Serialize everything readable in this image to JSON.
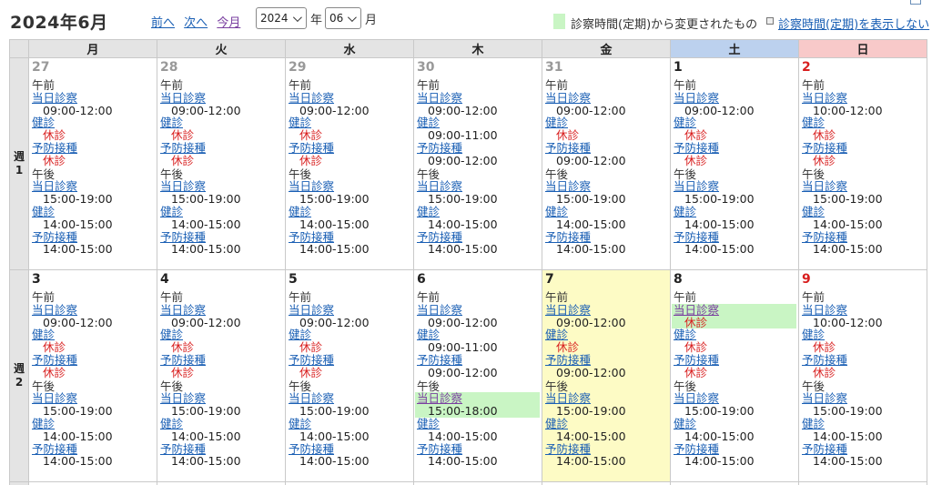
{
  "header": {
    "title": "2024年6月",
    "nav": {
      "prev": "前へ",
      "next": "次へ",
      "current": "今月"
    },
    "year_value": "2024",
    "year_unit": "年",
    "month_value": "06",
    "month_unit": "月",
    "legend_text": "診察時間(定期)から変更されたもの",
    "hide_link": "診察時間(定期)を表示しない",
    "colors": {
      "changed": "#c9f5c4",
      "today": "#fdfbc5",
      "saturday": "#bcd1ee",
      "sunday": "#f8c9c9"
    }
  },
  "weekdays": [
    "月",
    "火",
    "水",
    "木",
    "金",
    "土",
    "日"
  ],
  "weeks": [
    {
      "label": "週1",
      "days": [
        {
          "num": "27",
          "other": true,
          "am": [
            {
              "svc": "当日診察",
              "hrs": "09:00-12:00"
            },
            {
              "svc": "健診",
              "closed": "休診"
            },
            {
              "svc": "予防接種",
              "closed": "休診"
            }
          ],
          "pm": [
            {
              "svc": "当日診察",
              "hrs": "15:00-19:00"
            },
            {
              "svc": "健診",
              "hrs": "14:00-15:00"
            },
            {
              "svc": "予防接種",
              "hrs": "14:00-15:00"
            }
          ]
        },
        {
          "num": "28",
          "other": true,
          "am": [
            {
              "svc": "当日診察",
              "hrs": "09:00-12:00"
            },
            {
              "svc": "健診",
              "closed": "休診"
            },
            {
              "svc": "予防接種",
              "closed": "休診"
            }
          ],
          "pm": [
            {
              "svc": "当日診察",
              "hrs": "15:00-19:00"
            },
            {
              "svc": "健診",
              "hrs": "14:00-15:00"
            },
            {
              "svc": "予防接種",
              "hrs": "14:00-15:00"
            }
          ]
        },
        {
          "num": "29",
          "other": true,
          "am": [
            {
              "svc": "当日診察",
              "hrs": "09:00-12:00"
            },
            {
              "svc": "健診",
              "closed": "休診"
            },
            {
              "svc": "予防接種",
              "closed": "休診"
            }
          ],
          "pm": [
            {
              "svc": "当日診察",
              "hrs": "15:00-19:00"
            },
            {
              "svc": "健診",
              "hrs": "14:00-15:00"
            },
            {
              "svc": "予防接種",
              "hrs": "14:00-15:00"
            }
          ]
        },
        {
          "num": "30",
          "other": true,
          "am": [
            {
              "svc": "当日診察",
              "hrs": "09:00-12:00"
            },
            {
              "svc": "健診",
              "hrs": "09:00-11:00"
            },
            {
              "svc": "予防接種",
              "hrs": "09:00-12:00"
            }
          ],
          "pm": [
            {
              "svc": "当日診察",
              "hrs": "15:00-19:00"
            },
            {
              "svc": "健診",
              "hrs": "14:00-15:00"
            },
            {
              "svc": "予防接種",
              "hrs": "14:00-15:00"
            }
          ]
        },
        {
          "num": "31",
          "other": true,
          "am": [
            {
              "svc": "当日診察",
              "hrs": "09:00-12:00"
            },
            {
              "svc": "健診",
              "closed": "休診"
            },
            {
              "svc": "予防接種",
              "hrs": "09:00-12:00"
            }
          ],
          "pm": [
            {
              "svc": "当日診察",
              "hrs": "15:00-19:00"
            },
            {
              "svc": "健診",
              "hrs": "14:00-15:00"
            },
            {
              "svc": "予防接種",
              "hrs": "14:00-15:00"
            }
          ]
        },
        {
          "num": "1",
          "am": [
            {
              "svc": "当日診察",
              "hrs": "09:00-12:00"
            },
            {
              "svc": "健診",
              "closed": "休診"
            },
            {
              "svc": "予防接種",
              "closed": "休診"
            }
          ],
          "pm": [
            {
              "svc": "当日診察",
              "hrs": "15:00-19:00"
            },
            {
              "svc": "健診",
              "hrs": "14:00-15:00"
            },
            {
              "svc": "予防接種",
              "hrs": "14:00-15:00"
            }
          ]
        },
        {
          "num": "2",
          "sun": true,
          "am": [
            {
              "svc": "当日診察",
              "hrs": "10:00-12:00"
            },
            {
              "svc": "健診",
              "closed": "休診"
            },
            {
              "svc": "予防接種",
              "closed": "休診"
            }
          ],
          "pm": [
            {
              "svc": "当日診察",
              "hrs": "15:00-19:00"
            },
            {
              "svc": "健診",
              "hrs": "14:00-15:00"
            },
            {
              "svc": "予防接種",
              "hrs": "14:00-15:00"
            }
          ]
        }
      ]
    },
    {
      "label": "週2",
      "days": [
        {
          "num": "3",
          "am": [
            {
              "svc": "当日診察",
              "hrs": "09:00-12:00"
            },
            {
              "svc": "健診",
              "closed": "休診"
            },
            {
              "svc": "予防接種",
              "closed": "休診"
            }
          ],
          "pm": [
            {
              "svc": "当日診察",
              "hrs": "15:00-19:00"
            },
            {
              "svc": "健診",
              "hrs": "14:00-15:00"
            },
            {
              "svc": "予防接種",
              "hrs": "14:00-15:00"
            }
          ]
        },
        {
          "num": "4",
          "am": [
            {
              "svc": "当日診察",
              "hrs": "09:00-12:00"
            },
            {
              "svc": "健診",
              "closed": "休診"
            },
            {
              "svc": "予防接種",
              "closed": "休診"
            }
          ],
          "pm": [
            {
              "svc": "当日診察",
              "hrs": "15:00-19:00"
            },
            {
              "svc": "健診",
              "hrs": "14:00-15:00"
            },
            {
              "svc": "予防接種",
              "hrs": "14:00-15:00"
            }
          ]
        },
        {
          "num": "5",
          "am": [
            {
              "svc": "当日診察",
              "hrs": "09:00-12:00"
            },
            {
              "svc": "健診",
              "closed": "休診"
            },
            {
              "svc": "予防接種",
              "closed": "休診"
            }
          ],
          "pm": [
            {
              "svc": "当日診察",
              "hrs": "15:00-19:00"
            },
            {
              "svc": "健診",
              "hrs": "14:00-15:00"
            },
            {
              "svc": "予防接種",
              "hrs": "14:00-15:00"
            }
          ]
        },
        {
          "num": "6",
          "am": [
            {
              "svc": "当日診察",
              "hrs": "09:00-12:00"
            },
            {
              "svc": "健診",
              "hrs": "09:00-11:00"
            },
            {
              "svc": "予防接種",
              "hrs": "09:00-12:00"
            }
          ],
          "pm": [
            {
              "svc": "当日診察",
              "hrs": "15:00-18:00",
              "changed": true
            },
            {
              "svc": "健診",
              "hrs": "14:00-15:00"
            },
            {
              "svc": "予防接種",
              "hrs": "14:00-15:00"
            }
          ]
        },
        {
          "num": "7",
          "today": true,
          "am": [
            {
              "svc": "当日診察",
              "hrs": "09:00-12:00"
            },
            {
              "svc": "健診",
              "closed": "休診"
            },
            {
              "svc": "予防接種",
              "hrs": "09:00-12:00"
            }
          ],
          "pm": [
            {
              "svc": "当日診察",
              "hrs": "15:00-19:00"
            },
            {
              "svc": "健診",
              "hrs": "14:00-15:00"
            },
            {
              "svc": "予防接種",
              "hrs": "14:00-15:00"
            }
          ]
        },
        {
          "num": "8",
          "am": [
            {
              "svc": "当日診察",
              "closed": "休診",
              "changed": true
            },
            {
              "svc": "健診",
              "closed": "休診"
            },
            {
              "svc": "予防接種",
              "closed": "休診"
            }
          ],
          "pm": [
            {
              "svc": "当日診察",
              "hrs": "15:00-19:00"
            },
            {
              "svc": "健診",
              "hrs": "14:00-15:00"
            },
            {
              "svc": "予防接種",
              "hrs": "14:00-15:00"
            }
          ]
        },
        {
          "num": "9",
          "sun": true,
          "am": [
            {
              "svc": "当日診察",
              "hrs": "10:00-12:00"
            },
            {
              "svc": "健診",
              "closed": "休診"
            },
            {
              "svc": "予防接種",
              "closed": "休診"
            }
          ],
          "pm": [
            {
              "svc": "当日診察",
              "hrs": "15:00-19:00"
            },
            {
              "svc": "健診",
              "hrs": "14:00-15:00"
            },
            {
              "svc": "予防接種",
              "hrs": "14:00-15:00"
            }
          ]
        }
      ]
    }
  ],
  "periods": {
    "am": "午前",
    "pm": "午後"
  }
}
